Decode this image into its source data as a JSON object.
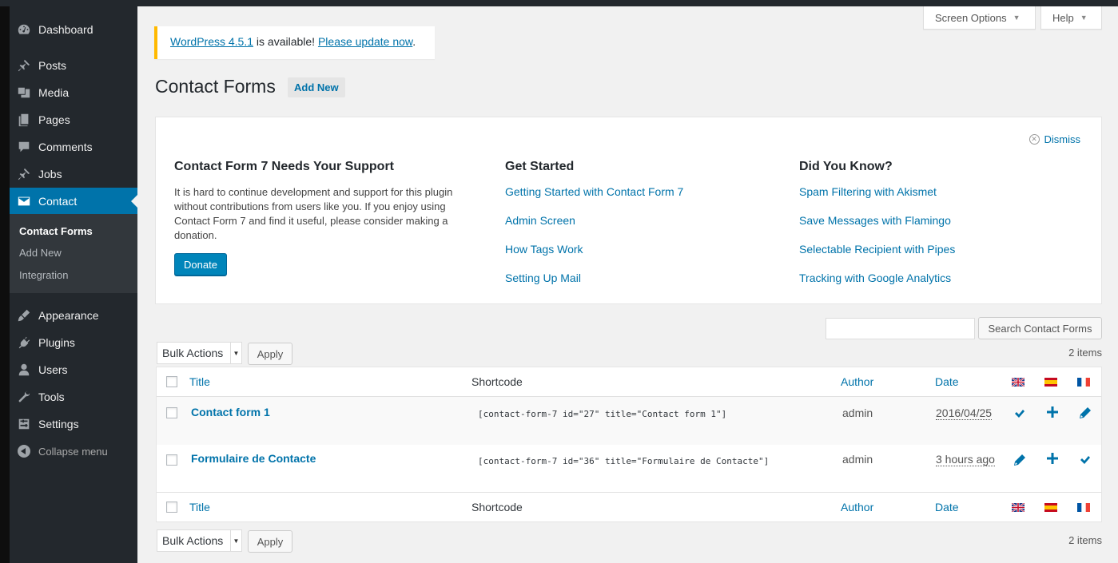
{
  "sidebar": {
    "items": [
      {
        "label": "Dashboard",
        "icon": "dashboard-icon"
      },
      {
        "label": "Posts",
        "icon": "pushpin-icon"
      },
      {
        "label": "Media",
        "icon": "media-icon"
      },
      {
        "label": "Pages",
        "icon": "pages-icon"
      },
      {
        "label": "Comments",
        "icon": "comments-icon"
      },
      {
        "label": "Jobs",
        "icon": "pushpin-icon"
      },
      {
        "label": "Contact",
        "icon": "envelope-icon"
      },
      {
        "label": "Appearance",
        "icon": "brush-icon"
      },
      {
        "label": "Plugins",
        "icon": "plug-icon"
      },
      {
        "label": "Users",
        "icon": "users-icon"
      },
      {
        "label": "Tools",
        "icon": "wrench-icon"
      },
      {
        "label": "Settings",
        "icon": "settings-icon"
      }
    ],
    "submenu": [
      "Contact Forms",
      "Add New",
      "Integration"
    ],
    "collapse": "Collapse menu"
  },
  "screen_options": "Screen Options",
  "help": "Help",
  "notice": {
    "version_link": "WordPress 4.5.1",
    "middle": " is available! ",
    "update_link": "Please update now",
    "end": "."
  },
  "page_title": "Contact Forms",
  "add_new": "Add New",
  "welcome": {
    "dismiss": "Dismiss",
    "support": {
      "heading": "Contact Form 7 Needs Your Support",
      "text": "It is hard to continue development and support for this plugin without contributions from users like you. If you enjoy using Contact Form 7 and find it useful, please consider making a donation.",
      "donate": "Donate"
    },
    "get_started": {
      "heading": "Get Started",
      "links": [
        "Getting Started with Contact Form 7",
        "Admin Screen",
        "How Tags Work",
        "Setting Up Mail"
      ]
    },
    "did_you_know": {
      "heading": "Did You Know?",
      "links": [
        "Spam Filtering with Akismet",
        "Save Messages with Flamingo",
        "Selectable Recipient with Pipes",
        "Tracking with Google Analytics"
      ]
    }
  },
  "search_button": "Search Contact Forms",
  "bulk_actions": "Bulk Actions",
  "apply": "Apply",
  "items_count": "2 items",
  "table": {
    "columns": {
      "title": "Title",
      "shortcode": "Shortcode",
      "author": "Author",
      "date": "Date"
    },
    "rows": [
      {
        "title": "Contact form 1",
        "shortcode": "[contact-form-7 id=\"27\" title=\"Contact form 1\"]",
        "author": "admin",
        "date": "2016/04/25",
        "lang_icons": [
          "checkmark-icon",
          "plus-icon",
          "pencil-icon"
        ]
      },
      {
        "title": "Formulaire de Contacte",
        "shortcode": "[contact-form-7 id=\"36\" title=\"Formulaire de Contacte\"]",
        "author": "admin",
        "date": "3 hours ago",
        "lang_icons": [
          "pencil-icon",
          "plus-icon",
          "checkmark-icon"
        ]
      }
    ]
  },
  "colors": {
    "accent": "#0073aa",
    "sidebar": "#23282d",
    "notice": "#ffb900"
  }
}
